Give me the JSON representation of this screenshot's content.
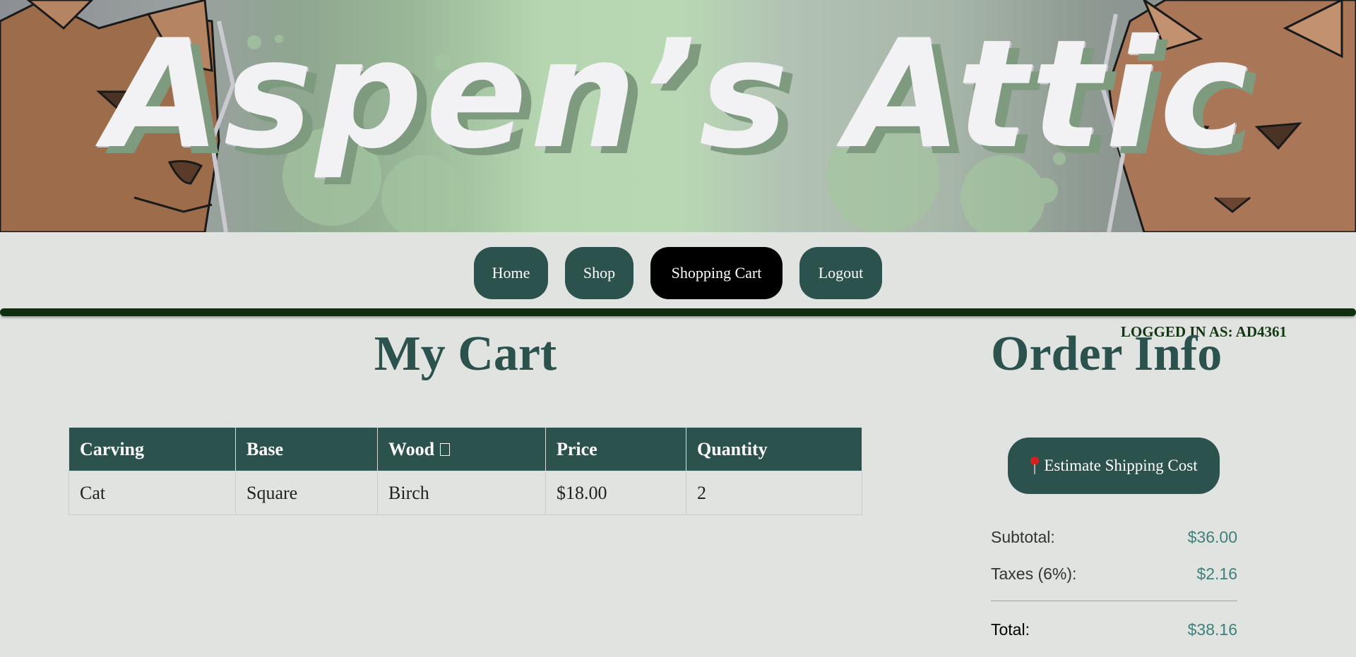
{
  "banner": {
    "title": "Aspen’s Attic"
  },
  "nav": {
    "items": [
      {
        "label": "Home",
        "active": false
      },
      {
        "label": "Shop",
        "active": false
      },
      {
        "label": "Shopping Cart",
        "active": true
      },
      {
        "label": "Logout",
        "active": false
      }
    ]
  },
  "user": {
    "logged_in_label": "LOGGED IN AS: AD4361"
  },
  "cart": {
    "title": "My Cart",
    "columns": [
      "Carving",
      "Base",
      "Wood",
      "Price",
      "Quantity"
    ],
    "rows": [
      [
        "Cat",
        "Square",
        "Birch",
        "$18.00",
        "2"
      ]
    ]
  },
  "order": {
    "title": "Order Info",
    "ship_button_label": "Estimate Shipping Cost",
    "subtotal_label": "Subtotal:",
    "subtotal_value": "$36.00",
    "taxes_label": "Taxes (6%):",
    "taxes_value": "$2.16",
    "total_label": "Total:",
    "total_value": "$38.16"
  },
  "colors": {
    "primary": "#2c524e",
    "active_nav": "#000000",
    "divider": "#0e2f0e",
    "value_text": "#3f807c"
  }
}
